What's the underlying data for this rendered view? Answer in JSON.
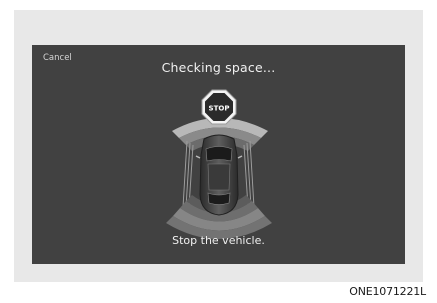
{
  "screen": {
    "cancel_label": "Cancel",
    "title": "Checking space...",
    "status": "Stop the vehicle.",
    "stop_sign_label": "STOP"
  },
  "figure_code": "ONE1071221L",
  "icons": [
    "stop-sign-icon",
    "car-icon",
    "sensor-arc-icon"
  ],
  "colors": {
    "screen_bg": "#414141",
    "frame_bg": "#e8e8e8",
    "text": "#f0f0f0"
  }
}
